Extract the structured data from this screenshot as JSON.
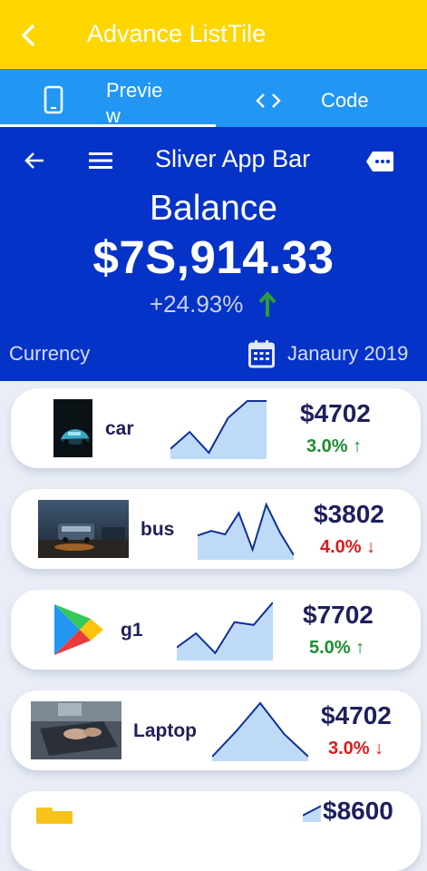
{
  "app_bar": {
    "title": "Advance ListTile",
    "back_icon": "chevron-left-icon"
  },
  "tabs": [
    {
      "label": "Preview",
      "icon": "phone-icon",
      "selected": true
    },
    {
      "label": "Code",
      "icon": "code-icon",
      "selected": false
    }
  ],
  "header": {
    "title": "Sliver App Bar",
    "balance_label": "Balance",
    "balance_value": "$7S,914.33",
    "balance_change": "+24.93%",
    "currency_label": "Currency",
    "date": "Janaury 2019",
    "colors": {
      "bg": "#0633c7",
      "up": "#2e9a3a"
    }
  },
  "items": [
    {
      "name": "car",
      "price": "$4702",
      "change": "3.0%",
      "direction": "up",
      "thumb": "car-photo",
      "spark": [
        0.15,
        0.45,
        0.08,
        0.7,
        1.0,
        1.0
      ]
    },
    {
      "name": "bus",
      "price": "$3802",
      "change": "4.0%",
      "direction": "down",
      "thumb": "bus-photo",
      "spark": [
        0.4,
        0.48,
        0.42,
        0.8,
        0.15,
        0.95,
        0.45,
        0.05
      ]
    },
    {
      "name": "g1",
      "price": "$7702",
      "change": "5.0%",
      "direction": "up",
      "thumb": "play-store-logo",
      "spark": [
        0.2,
        0.45,
        0.1,
        0.65,
        0.6,
        1.0
      ]
    },
    {
      "name": "Laptop",
      "price": "$4702",
      "change": "3.0%",
      "direction": "down",
      "thumb": "laptop-photo",
      "spark": [
        0.05,
        0.5,
        1.0,
        0.45,
        0.05
      ]
    },
    {
      "name": "",
      "price": "$8600",
      "change": "",
      "direction": "up",
      "thumb": "folder-icon",
      "spark": [
        0.2,
        0.6
      ]
    }
  ]
}
